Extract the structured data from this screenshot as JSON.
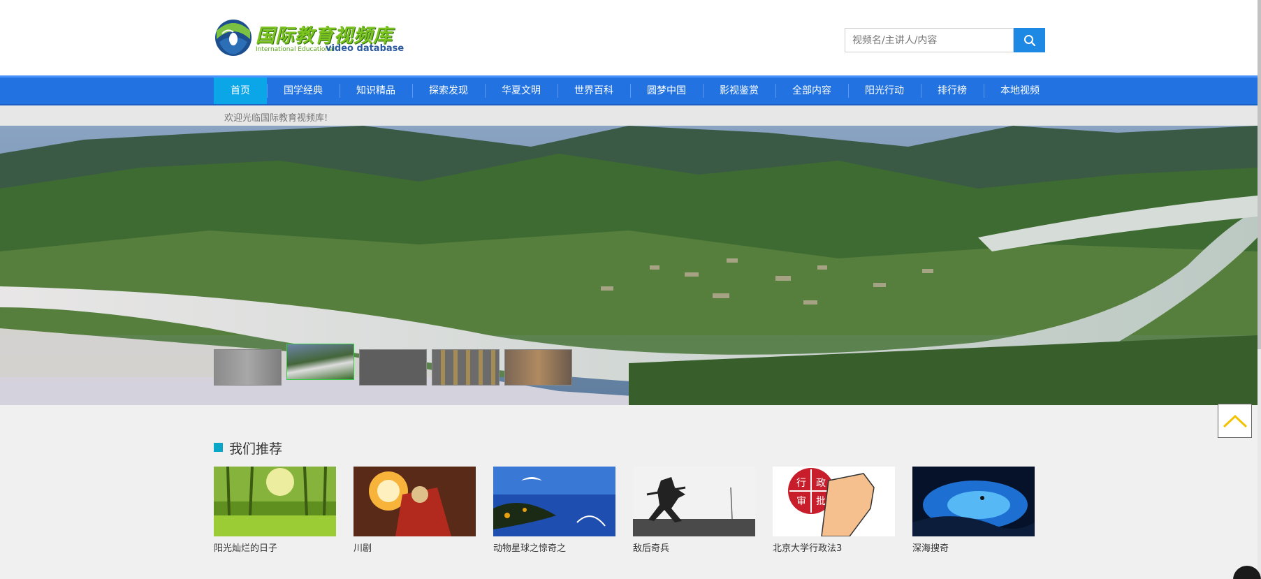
{
  "header": {
    "logo_title": "国际教育视频库",
    "logo_sub1": "International Educational",
    "logo_sub2": "video database"
  },
  "search": {
    "placeholder": "视频名/主讲人/内容",
    "icon": "search-icon"
  },
  "nav": {
    "items": [
      {
        "label": "首页",
        "active": true
      },
      {
        "label": "国学经典"
      },
      {
        "label": "知识精品"
      },
      {
        "label": "探索发现"
      },
      {
        "label": "华夏文明"
      },
      {
        "label": "世界百科"
      },
      {
        "label": "圆梦中国"
      },
      {
        "label": "影视鉴赏"
      },
      {
        "label": "全部内容"
      },
      {
        "label": "阳光行动"
      },
      {
        "label": "排行榜"
      },
      {
        "label": "本地视频"
      }
    ]
  },
  "welcome": "欢迎光临国际教育视频库!",
  "banner": {
    "active_slide": 2,
    "slide_count": 5
  },
  "recommend": {
    "title": "我们推荐",
    "items": [
      {
        "title": "阳光灿烂的日子"
      },
      {
        "title": "川剧"
      },
      {
        "title": "动物星球之惊奇之"
      },
      {
        "title": "敌后奇兵"
      },
      {
        "title": "北京大学行政法3"
      },
      {
        "title": "深海搜奇"
      }
    ],
    "badge_chars": [
      "行",
      "政",
      "审",
      "批"
    ]
  },
  "colors": {
    "nav_bg": "#2273e1",
    "nav_active": "#0aa6e8",
    "search_button": "#1e88e5",
    "section_mark": "#0aa6c8",
    "back_top_arrow": "#f2c200"
  },
  "icons": {
    "back_to_top": "chevron-up-icon",
    "logo": "globe-logo-icon"
  }
}
